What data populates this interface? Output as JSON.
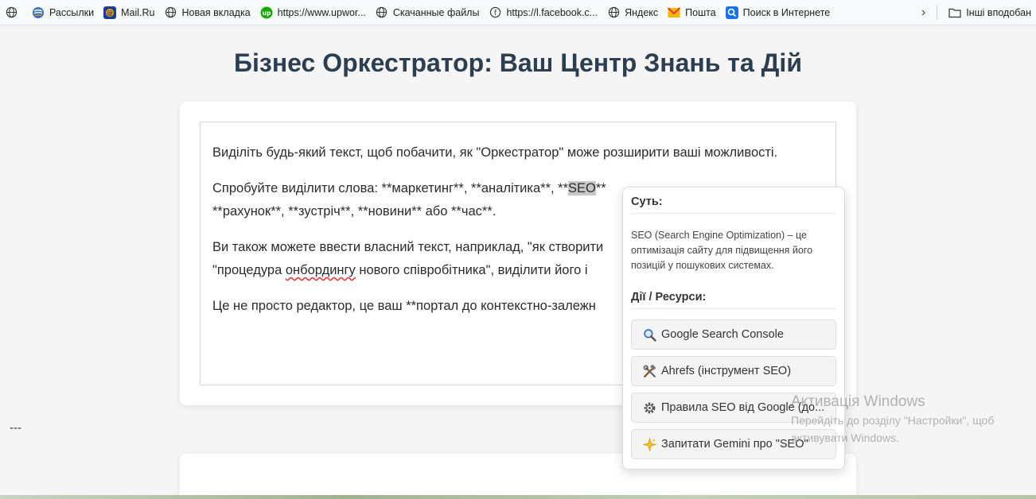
{
  "bookmarks": [
    {
      "icon": "globe-icon",
      "label": ""
    },
    {
      "icon": "rassylki-icon",
      "label": "Рассылки"
    },
    {
      "icon": "mailru-icon",
      "label": "Mail.Ru"
    },
    {
      "icon": "globe-icon",
      "label": "Новая вкладка"
    },
    {
      "icon": "upwork-icon",
      "label": "https://www.upwor..."
    },
    {
      "icon": "globe-icon",
      "label": "Скачанные файлы"
    },
    {
      "icon": "facebook-icon",
      "label": "https://l.facebook.c..."
    },
    {
      "icon": "globe-icon",
      "label": "Яндекс"
    },
    {
      "icon": "mail-icon",
      "label": "Пошта"
    },
    {
      "icon": "search-icon",
      "label": "Поиск в Интернете"
    }
  ],
  "other_bookmarks": "Інші вподобан",
  "page": {
    "title": "Бізнес Оркестратор: Ваш Центр Знань та Дій",
    "p1": "Виділіть будь-який текст, щоб побачити, як \"Оркестратор\" може розширити ваші можливості.",
    "p2_before": "Спробуйте виділити слова: **маркетинг**, **аналітика**, **",
    "p2_highlight": "SEO",
    "p2_after": "**",
    "p2_line2": "**рахунок**, **зустріч**, **новини** або **час**.",
    "p3_line1": "Ви також можете ввести власний текст, наприклад, \"як створити",
    "p3_line2_before": "\"процедура ",
    "p3_line2_squiggle": "онбордингу",
    "p3_line2_after": " нового співробітника\", виділити його і",
    "p4": "Це не просто редактор, це ваш **портал до контекстно-залежн",
    "divider": "---"
  },
  "popup": {
    "essence_heading": "Суть:",
    "description": "SEO (Search Engine Optimization) – це оптимізація сайту для підвищення його позицій у пошукових системах.",
    "actions_heading": "Дії / Ресурси:",
    "buttons": [
      {
        "icon": "magnifier-icon",
        "label": "Google Search Console"
      },
      {
        "icon": "tools-icon",
        "label": "Ahrefs (інструмент SEO)"
      },
      {
        "icon": "gear-icon",
        "label": "Правила SEO від Google (до..."
      },
      {
        "icon": "sparkle-icon",
        "label": "Запитати Gemini про \"SEO\""
      }
    ]
  },
  "watermark": {
    "title": "Активація Windows",
    "line1": "Перейдіть до розділу \"Настройки\", щоб",
    "line2": "активувати Windows."
  }
}
